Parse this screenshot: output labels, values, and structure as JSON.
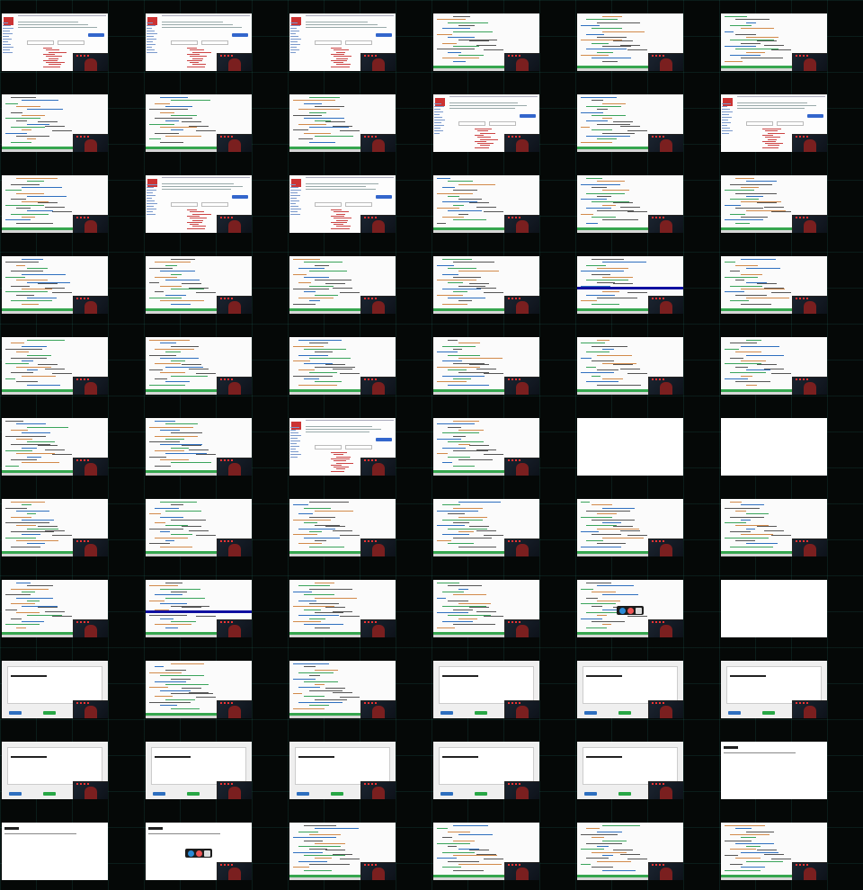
{
  "grid": {
    "rows": 11,
    "cols": 6
  },
  "tiles": [
    [
      "wiki",
      "wiki",
      "wiki",
      "code",
      "code",
      "code"
    ],
    [
      "code",
      "code",
      "code",
      "wiki",
      "code",
      "wiki"
    ],
    [
      "code",
      "wiki",
      "wiki",
      "code",
      "code",
      "code"
    ],
    [
      "code",
      "code",
      "code",
      "code",
      "code-stripe",
      "code"
    ],
    [
      "code",
      "code",
      "code",
      "code",
      "code",
      "code"
    ],
    [
      "code",
      "code",
      "wiki",
      "code",
      "blank",
      "blank"
    ],
    [
      "code",
      "code",
      "code",
      "code",
      "code",
      "code"
    ],
    [
      "code",
      "code-stripe",
      "code",
      "code",
      "code-dock",
      "blank"
    ],
    [
      "diff",
      "code",
      "code",
      "diff",
      "diff",
      "diff"
    ],
    [
      "diff",
      "diff",
      "diff",
      "diff",
      "diff",
      "notfound"
    ],
    [
      "notfound",
      "notfound-dock",
      "code",
      "code",
      "code",
      "code"
    ]
  ],
  "icons": {
    "dock": "dock-icons",
    "webcam": "webcam-icon"
  }
}
